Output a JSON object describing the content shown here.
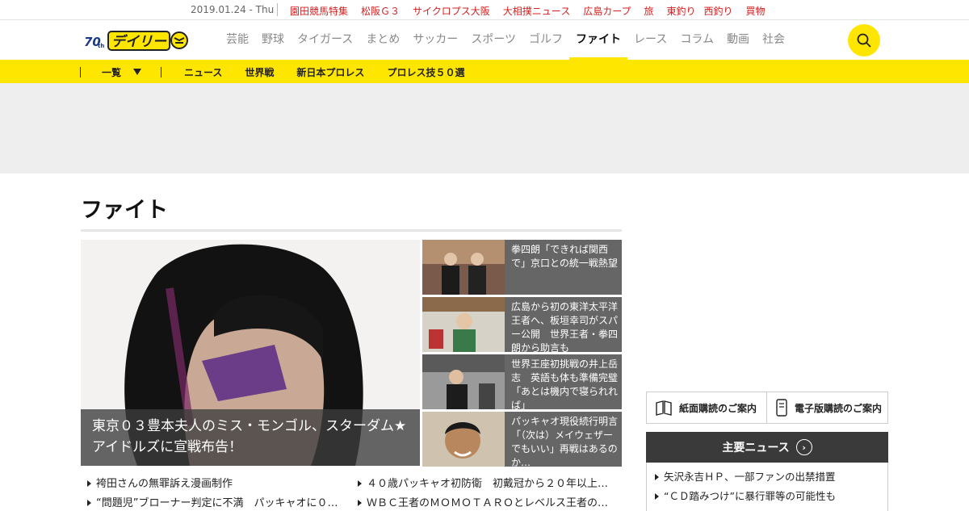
{
  "topbar": {
    "date": "2019.01.24 - Thu",
    "links": [
      "園田競馬特集",
      "松阪Ｇ３",
      "サイクロプス大阪",
      "大相撲ニュース",
      "広島カープ",
      "旅",
      "東釣り",
      "西釣り",
      "買物"
    ]
  },
  "header": {
    "logo_text": "デイリー",
    "logo_badge": "70th",
    "nav": [
      "芸能",
      "野球",
      "タイガース",
      "まとめ",
      "サッカー",
      "スポーツ",
      "ゴルフ",
      "ファイト",
      "レース",
      "コラム",
      "動画",
      "社会"
    ],
    "active_nav": "ファイト",
    "search_icon": "search-icon"
  },
  "subnav": {
    "all_label": "一覧",
    "links": [
      "ニュース",
      "世界戦",
      "新日本プロレス",
      "プロレス技５０選"
    ]
  },
  "colors": {
    "accent": "#ffe600",
    "link_red": "#d32020",
    "dark": "#3a3a3a"
  },
  "main": {
    "title": "ファイト",
    "hero": {
      "caption": "東京０３豊本夫人のミス・モンゴル、スターダム★アイドルズに宣戦布告！"
    },
    "side_stories": [
      {
        "text": "拳四朗「できれば関西で」京口との統一戦熱望"
      },
      {
        "text": "広島から初の東洋太平洋王者へ、板垣幸司がスパー公開　世界王者・拳四朗から助言も"
      },
      {
        "text": "世界王座初挑戦の井上岳志　英語も体も準備完璧「あとは機内で寝られれば」"
      },
      {
        "text": "パッキャオ現役続行明言「（次は）メイウェザーでもいい」再戦はあるのか…"
      }
    ],
    "headlines_left": [
      "袴田さんの無罪訴え漫画制作",
      "“問題児”ブローナー判定に不満　パッキャオに０…"
    ],
    "headlines_right": [
      "４０歳パッキャオ初防衛　初戴冠から２０年以上…",
      "ＷＢＣ王者のＭＯＭＯＴＡＲＯとレベルス王者の…"
    ]
  },
  "sidebar": {
    "paper_sub": "紙面購読のご案内",
    "digital_sub": "電子版購読のご案内",
    "major_news_title": "主要ニュース",
    "major_news": [
      "矢沢永吉ＨＰ、一部ファンの出禁措置",
      "“ＣＤ踏みつけ”に暴行罪等の可能性も"
    ]
  }
}
